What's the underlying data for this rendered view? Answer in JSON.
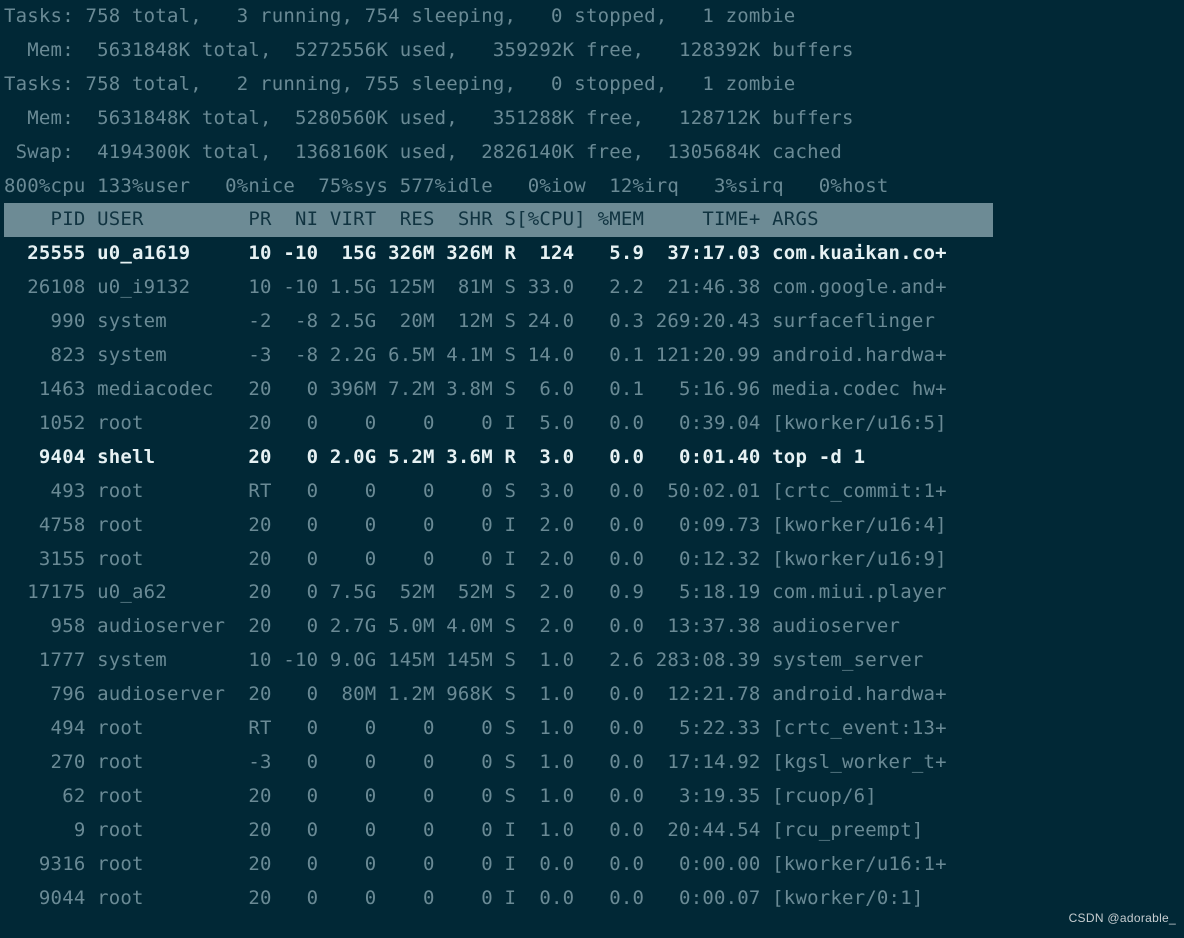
{
  "summary": [
    "Tasks: 758 total,   3 running, 754 sleeping,   0 stopped,   1 zombie",
    "  Mem:  5631848K total,  5272556K used,   359292K free,   128392K buffers",
    "Tasks: 758 total,   2 running, 755 sleeping,   0 stopped,   1 zombie",
    "  Mem:  5631848K total,  5280560K used,   351288K free,   128712K buffers",
    " Swap:  4194300K total,  1368160K used,  2826140K free,  1305684K cached",
    "800%cpu 133%user   0%nice  75%sys 577%idle   0%iow  12%irq   3%sirq   0%host"
  ],
  "header": "    PID USER         PR  NI VIRT  RES  SHR S[%CPU] %MEM     TIME+ ARGS               ",
  "rows": [
    {
      "pid": "25555",
      "user": "u0_a1619",
      "pr": "10",
      "ni": "-10",
      "virt": "15G",
      "res": "326M",
      "shr": "326M",
      "s": "R",
      "cpu": "124",
      "mem": "5.9",
      "time": "37:17.03",
      "args": "com.kuaikan.co+",
      "bold": true
    },
    {
      "pid": "26108",
      "user": "u0_i9132",
      "pr": "10",
      "ni": "-10",
      "virt": "1.5G",
      "res": "125M",
      "shr": "81M",
      "s": "S",
      "cpu": "33.0",
      "mem": "2.2",
      "time": "21:46.38",
      "args": "com.google.and+"
    },
    {
      "pid": "990",
      "user": "system",
      "pr": "-2",
      "ni": "-8",
      "virt": "2.5G",
      "res": "20M",
      "shr": "12M",
      "s": "S",
      "cpu": "24.0",
      "mem": "0.3",
      "time": "269:20.43",
      "args": "surfaceflinger"
    },
    {
      "pid": "823",
      "user": "system",
      "pr": "-3",
      "ni": "-8",
      "virt": "2.2G",
      "res": "6.5M",
      "shr": "4.1M",
      "s": "S",
      "cpu": "14.0",
      "mem": "0.1",
      "time": "121:20.99",
      "args": "android.hardwa+"
    },
    {
      "pid": "1463",
      "user": "mediacodec",
      "pr": "20",
      "ni": "0",
      "virt": "396M",
      "res": "7.2M",
      "shr": "3.8M",
      "s": "S",
      "cpu": "6.0",
      "mem": "0.1",
      "time": "5:16.96",
      "args": "media.codec hw+"
    },
    {
      "pid": "1052",
      "user": "root",
      "pr": "20",
      "ni": "0",
      "virt": "0",
      "res": "0",
      "shr": "0",
      "s": "I",
      "cpu": "5.0",
      "mem": "0.0",
      "time": "0:39.04",
      "args": "[kworker/u16:5]"
    },
    {
      "pid": "9404",
      "user": "shell",
      "pr": "20",
      "ni": "0",
      "virt": "2.0G",
      "res": "5.2M",
      "shr": "3.6M",
      "s": "R",
      "cpu": "3.0",
      "mem": "0.0",
      "time": "0:01.40",
      "args": "top -d 1",
      "bold": true
    },
    {
      "pid": "493",
      "user": "root",
      "pr": "RT",
      "ni": "0",
      "virt": "0",
      "res": "0",
      "shr": "0",
      "s": "S",
      "cpu": "3.0",
      "mem": "0.0",
      "time": "50:02.01",
      "args": "[crtc_commit:1+"
    },
    {
      "pid": "4758",
      "user": "root",
      "pr": "20",
      "ni": "0",
      "virt": "0",
      "res": "0",
      "shr": "0",
      "s": "I",
      "cpu": "2.0",
      "mem": "0.0",
      "time": "0:09.73",
      "args": "[kworker/u16:4]"
    },
    {
      "pid": "3155",
      "user": "root",
      "pr": "20",
      "ni": "0",
      "virt": "0",
      "res": "0",
      "shr": "0",
      "s": "I",
      "cpu": "2.0",
      "mem": "0.0",
      "time": "0:12.32",
      "args": "[kworker/u16:9]"
    },
    {
      "pid": "17175",
      "user": "u0_a62",
      "pr": "20",
      "ni": "0",
      "virt": "7.5G",
      "res": "52M",
      "shr": "52M",
      "s": "S",
      "cpu": "2.0",
      "mem": "0.9",
      "time": "5:18.19",
      "args": "com.miui.player"
    },
    {
      "pid": "958",
      "user": "audioserver",
      "pr": "20",
      "ni": "0",
      "virt": "2.7G",
      "res": "5.0M",
      "shr": "4.0M",
      "s": "S",
      "cpu": "2.0",
      "mem": "0.0",
      "time": "13:37.38",
      "args": "audioserver"
    },
    {
      "pid": "1777",
      "user": "system",
      "pr": "10",
      "ni": "-10",
      "virt": "9.0G",
      "res": "145M",
      "shr": "145M",
      "s": "S",
      "cpu": "1.0",
      "mem": "2.6",
      "time": "283:08.39",
      "args": "system_server"
    },
    {
      "pid": "796",
      "user": "audioserver",
      "pr": "20",
      "ni": "0",
      "virt": "80M",
      "res": "1.2M",
      "shr": "968K",
      "s": "S",
      "cpu": "1.0",
      "mem": "0.0",
      "time": "12:21.78",
      "args": "android.hardwa+"
    },
    {
      "pid": "494",
      "user": "root",
      "pr": "RT",
      "ni": "0",
      "virt": "0",
      "res": "0",
      "shr": "0",
      "s": "S",
      "cpu": "1.0",
      "mem": "0.0",
      "time": "5:22.33",
      "args": "[crtc_event:13+"
    },
    {
      "pid": "270",
      "user": "root",
      "pr": "-3",
      "ni": "0",
      "virt": "0",
      "res": "0",
      "shr": "0",
      "s": "S",
      "cpu": "1.0",
      "mem": "0.0",
      "time": "17:14.92",
      "args": "[kgsl_worker_t+"
    },
    {
      "pid": "62",
      "user": "root",
      "pr": "20",
      "ni": "0",
      "virt": "0",
      "res": "0",
      "shr": "0",
      "s": "S",
      "cpu": "1.0",
      "mem": "0.0",
      "time": "3:19.35",
      "args": "[rcuop/6]"
    },
    {
      "pid": "9",
      "user": "root",
      "pr": "20",
      "ni": "0",
      "virt": "0",
      "res": "0",
      "shr": "0",
      "s": "I",
      "cpu": "1.0",
      "mem": "0.0",
      "time": "20:44.54",
      "args": "[rcu_preempt]"
    },
    {
      "pid": "9316",
      "user": "root",
      "pr": "20",
      "ni": "0",
      "virt": "0",
      "res": "0",
      "shr": "0",
      "s": "I",
      "cpu": "0.0",
      "mem": "0.0",
      "time": "0:00.00",
      "args": "[kworker/u16:1+"
    },
    {
      "pid": "9044",
      "user": "root",
      "pr": "20",
      "ni": "0",
      "virt": "0",
      "res": "0",
      "shr": "0",
      "s": "I",
      "cpu": "0.0",
      "mem": "0.0",
      "time": "0:00.07",
      "args": "[kworker/0:1]"
    }
  ],
  "watermark": "CSDN @adorable_"
}
